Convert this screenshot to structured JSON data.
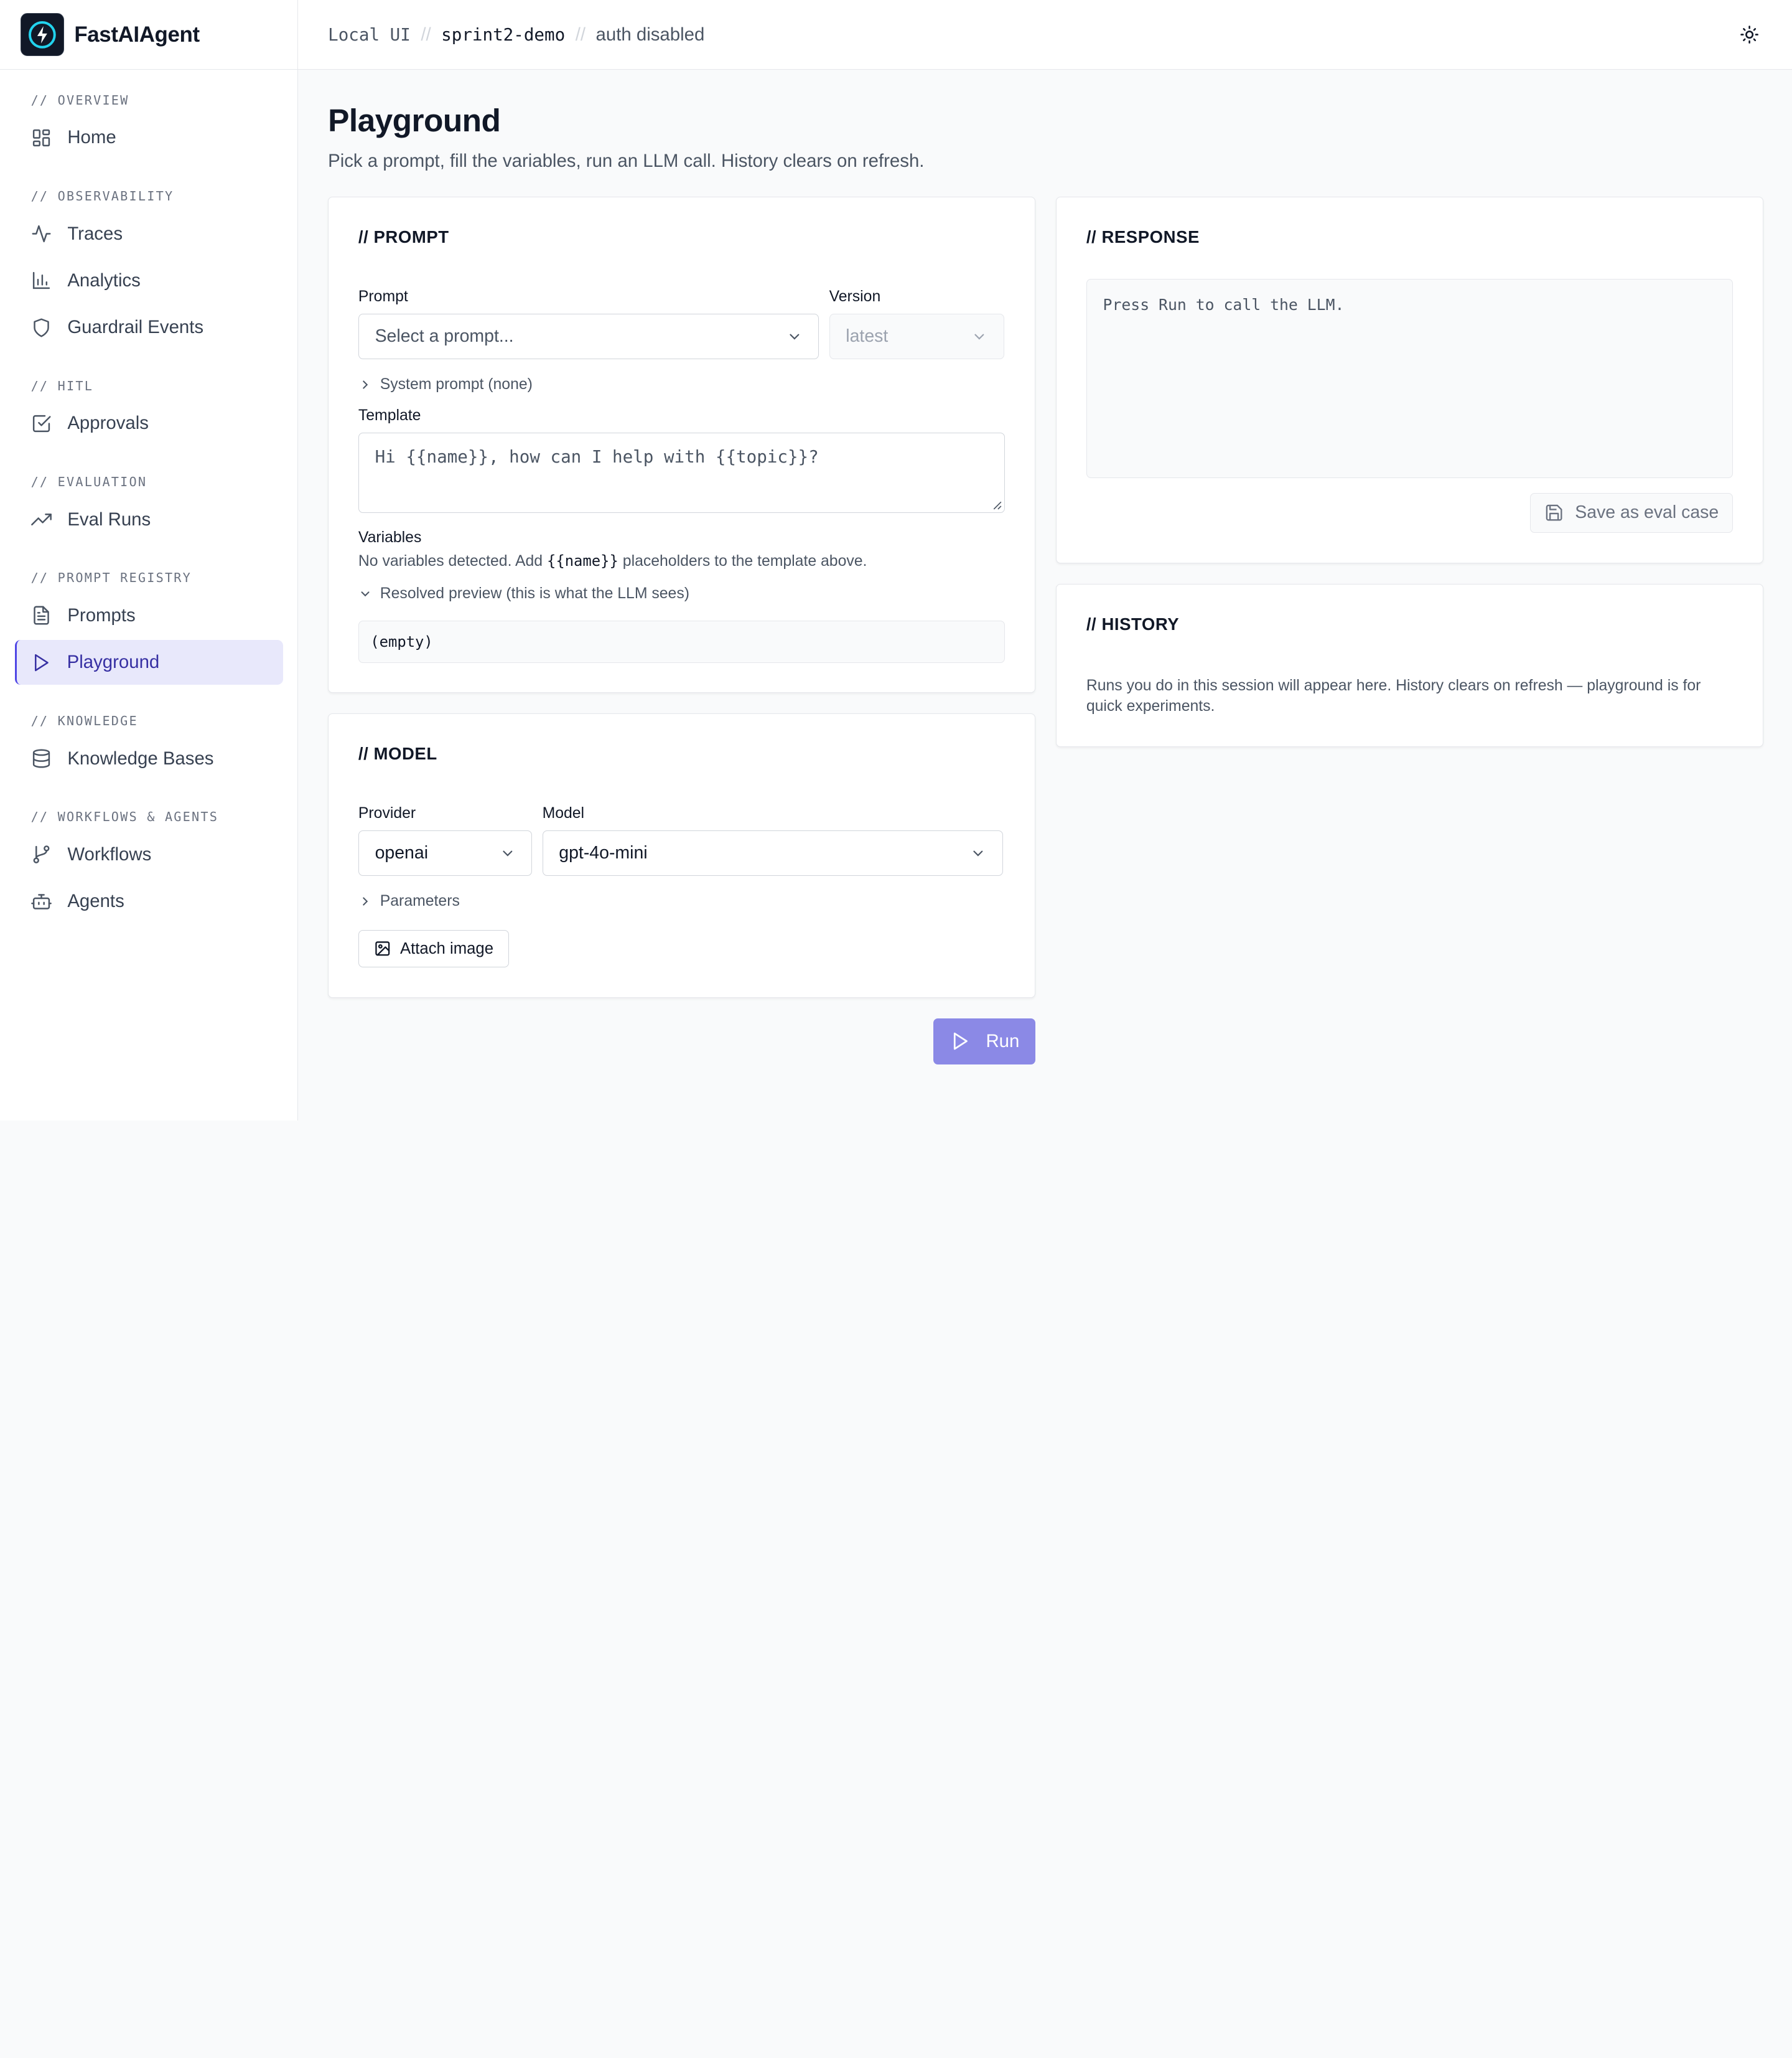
{
  "brand": {
    "name": "FastAIAgent"
  },
  "topbar": {
    "crumb1": "Local UI",
    "crumb2": "sprint2-demo",
    "crumb3": "auth disabled",
    "sep": "//"
  },
  "sidebar": {
    "sections": [
      {
        "title": "// OVERVIEW",
        "items": [
          {
            "label": "Home",
            "icon": "grid-icon"
          }
        ]
      },
      {
        "title": "// OBSERVABILITY",
        "items": [
          {
            "label": "Traces",
            "icon": "activity-icon"
          },
          {
            "label": "Analytics",
            "icon": "bar-chart-icon"
          },
          {
            "label": "Guardrail Events",
            "icon": "shield-icon"
          }
        ]
      },
      {
        "title": "// HITL",
        "items": [
          {
            "label": "Approvals",
            "icon": "check-square-icon"
          }
        ]
      },
      {
        "title": "// EVALUATION",
        "items": [
          {
            "label": "Eval Runs",
            "icon": "trending-up-icon"
          }
        ]
      },
      {
        "title": "// PROMPT REGISTRY",
        "items": [
          {
            "label": "Prompts",
            "icon": "file-text-icon"
          },
          {
            "label": "Playground",
            "icon": "play-icon",
            "active": true
          }
        ]
      },
      {
        "title": "// KNOWLEDGE",
        "items": [
          {
            "label": "Knowledge Bases",
            "icon": "database-icon"
          }
        ]
      },
      {
        "title": "// WORKFLOWS & AGENTS",
        "items": [
          {
            "label": "Workflows",
            "icon": "git-branch-icon"
          },
          {
            "label": "Agents",
            "icon": "bot-icon"
          }
        ]
      }
    ]
  },
  "page": {
    "title": "Playground",
    "subtitle": "Pick a prompt, fill the variables, run an LLM call. History clears on refresh."
  },
  "prompt_card": {
    "title": "// PROMPT",
    "prompt_label": "Prompt",
    "prompt_placeholder": "Select a prompt...",
    "version_label": "Version",
    "version_value": "latest",
    "system_prompt": "System prompt (none)",
    "template_label": "Template",
    "template_value": "Hi {{name}}, how can I help with {{topic}}?",
    "variables_label": "Variables",
    "variables_hint_pre": "No variables detected. Add",
    "variables_hint_code": "{{name}}",
    "variables_hint_post": "placeholders to the template above.",
    "resolved_label": "Resolved preview (this is what the LLM sees)",
    "resolved_value": "(empty)"
  },
  "model_card": {
    "title": "// MODEL",
    "provider_label": "Provider",
    "provider_value": "openai",
    "model_label": "Model",
    "model_value": "gpt-4o-mini",
    "parameters_label": "Parameters",
    "attach_label": "Attach image"
  },
  "run_button": {
    "label": "Run"
  },
  "response_card": {
    "title": "// RESPONSE",
    "placeholder": "Press Run to call the LLM.",
    "save_label": "Save as eval case"
  },
  "history_card": {
    "title": "// HISTORY",
    "text": "Runs you do in this session will appear here. History clears on refresh — playground is for quick experiments."
  },
  "colors": {
    "accent": "#4f46e5",
    "active_bg": "#e8e8fb",
    "run_button": "#8b89e6"
  }
}
